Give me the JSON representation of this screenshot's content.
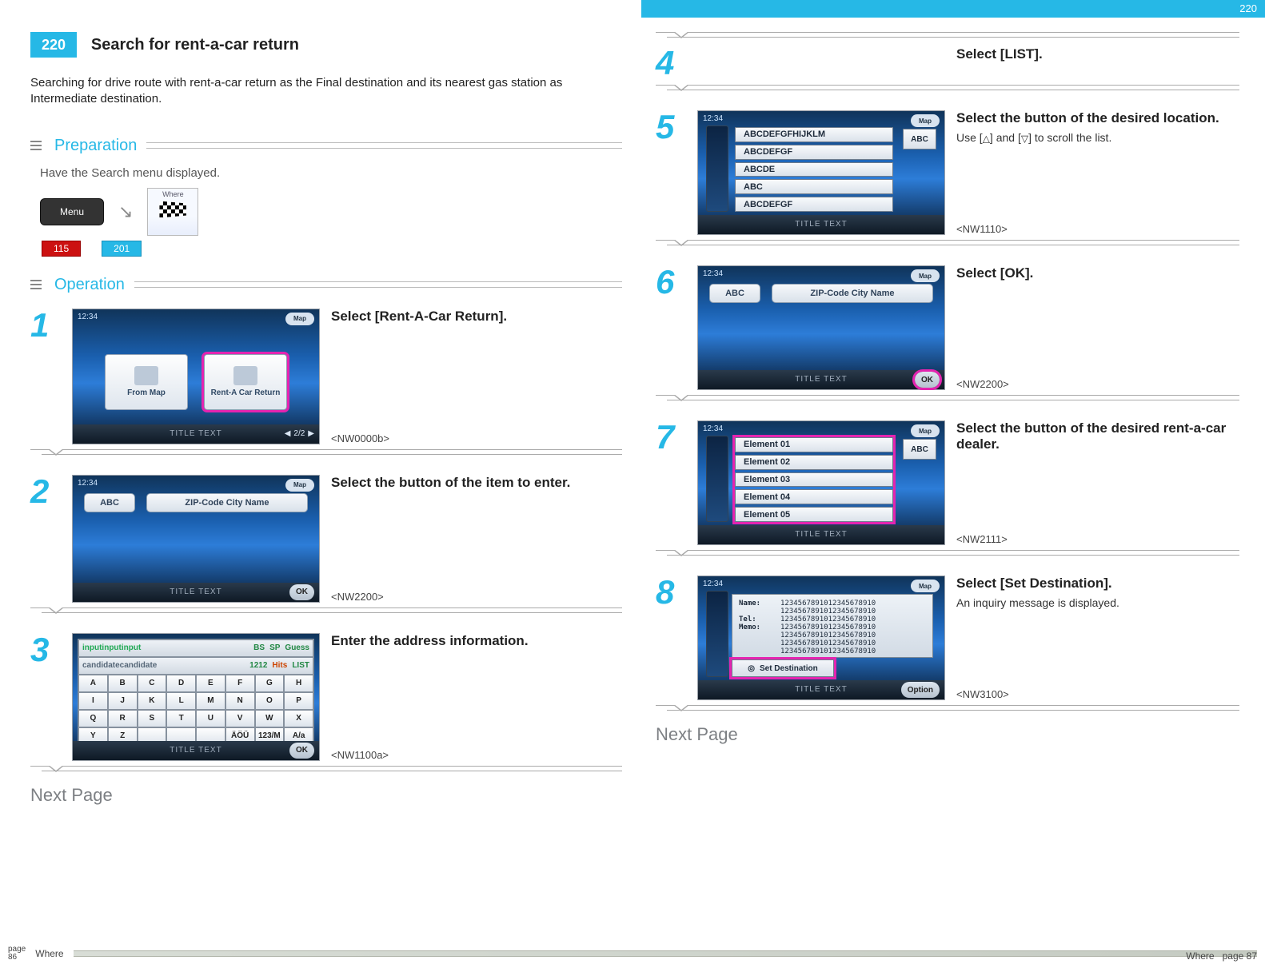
{
  "topbar": {
    "page_ref_right": "220"
  },
  "header": {
    "section_number": "220",
    "title": "Search for rent-a-car return"
  },
  "intro": "Searching for drive route with rent-a-car return as the Final destination and its nearest gas station as Intermediate destination.",
  "preparation": {
    "label": "Preparation",
    "text": "Have the Search menu displayed.",
    "menu_label": "Menu",
    "where_label": "Where",
    "tag_red": "115",
    "tag_blue": "201"
  },
  "operation": {
    "label": "Operation"
  },
  "steps": {
    "s1": {
      "num": "1",
      "headline": "Select [Rent-A-Car Return].",
      "code": "<NW0000b>",
      "shot": {
        "time": "12:34",
        "map": "Map",
        "card_a": "From Map",
        "card_b": "Rent-A Car Return",
        "title": "TITLE TEXT",
        "pager": "2/2"
      }
    },
    "s2": {
      "num": "2",
      "headline": "Select the button of the item to enter.",
      "code": "<NW2200>",
      "shot": {
        "time": "12:34",
        "map": "Map",
        "pill_a": "ABC",
        "pill_b": "ZIP-Code City Name",
        "title": "TITLE TEXT",
        "ok": "OK"
      }
    },
    "s3": {
      "num": "3",
      "headline": "Enter the address information.",
      "code": "<NW1100a>",
      "shot": {
        "input": "inputinputinput",
        "bs": "BS",
        "sp": "SP",
        "guess": "Guess",
        "cand": "candidatecandidate",
        "count": "1212",
        "hits": "Hits",
        "list": "LIST",
        "rows": [
          [
            "A",
            "B",
            "C",
            "D",
            "E",
            "F",
            "G",
            "H"
          ],
          [
            "I",
            "J",
            "K",
            "L",
            "M",
            "N",
            "O",
            "P"
          ],
          [
            "Q",
            "R",
            "S",
            "T",
            "U",
            "V",
            "W",
            "X"
          ],
          [
            "Y",
            "Z",
            "",
            "",
            "",
            "ÄÖÜ",
            "123/M",
            "A/a"
          ]
        ],
        "title": "TITLE TEXT",
        "ok": "OK"
      }
    },
    "s4": {
      "num": "4",
      "headline": "Select [LIST]."
    },
    "s5": {
      "num": "5",
      "headline": "Select the button of the desired location.",
      "sub_pre": "Use [",
      "sub_mid": "] and [",
      "sub_post": "] to scroll the list.",
      "code": "<NW1110>",
      "shot": {
        "time": "12:34",
        "map": "Map",
        "abc": "ABC",
        "items": [
          "ABCDEFGFHIJKLM",
          "ABCDEFGF",
          "ABCDE",
          "ABC",
          "ABCDEFGF"
        ],
        "title": "TITLE TEXT"
      }
    },
    "s6": {
      "num": "6",
      "headline": "Select [OK].",
      "code": "<NW2200>",
      "shot": {
        "time": "12:34",
        "map": "Map",
        "pill_a": "ABC",
        "pill_b": "ZIP-Code City Name",
        "title": "TITLE TEXT",
        "ok": "OK"
      }
    },
    "s7": {
      "num": "7",
      "headline": "Select the button of the desired rent-a-car dealer.",
      "code": "<NW2111>",
      "shot": {
        "time": "12:34",
        "map": "Map",
        "abc": "ABC",
        "items": [
          "Element 01",
          "Element 02",
          "Element 03",
          "Element 04",
          "Element 05"
        ],
        "title": "TITLE TEXT"
      }
    },
    "s8": {
      "num": "8",
      "headline": "Select [Set Destination].",
      "sub": "An inquiry message is displayed.",
      "code": "<NW3100>",
      "shot": {
        "time": "12:34",
        "map": "Map",
        "name_k": "Name:",
        "tel_k": "Tel:",
        "memo_k": "Memo:",
        "val": "12345678910123456789​10",
        "btn": "Set Destination",
        "title": "TITLE TEXT",
        "opt": "Option"
      }
    }
  },
  "next_page": "Next Page",
  "footer": {
    "left_page_label": "page",
    "left_page_num": "86",
    "left_section": "Where",
    "right_section": "Where",
    "right_page_label": "page",
    "right_page_num": "87"
  }
}
